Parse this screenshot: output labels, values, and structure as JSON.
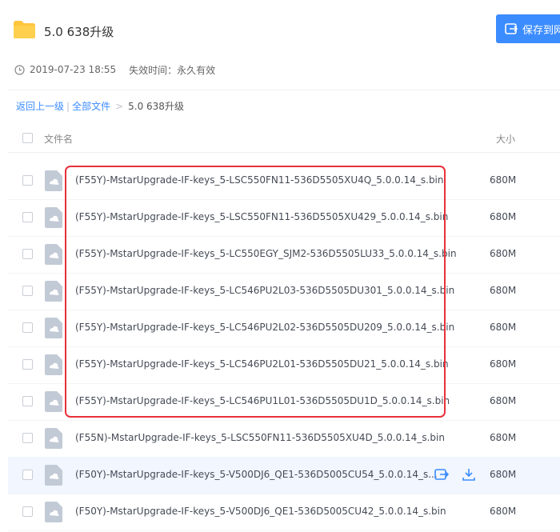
{
  "header": {
    "folder_name": "5.0 638升级",
    "save_button_label": "保存到网盘"
  },
  "meta": {
    "date": "2019-07-23 18:55",
    "expire_label": "失效时间：",
    "expire_value": "永久有效"
  },
  "breadcrumb": {
    "back": "返回上一级",
    "separator": "|",
    "all_files": "全部文件",
    "chevron": ">",
    "current": "5.0 638升级"
  },
  "list": {
    "header_name": "文件名",
    "header_size": "大小",
    "rows": [
      {
        "name": "(F55Y)-MstarUpgrade-IF-keys_5-LSC550FN11-536D5505XU4Q_5.0.0.14_s.bin",
        "size": "680M"
      },
      {
        "name": "(F55Y)-MstarUpgrade-IF-keys_5-LSC550FN11-536D5505XU429_5.0.0.14_s.bin",
        "size": "680M"
      },
      {
        "name": "(F55Y)-MstarUpgrade-IF-keys_5-LC550EGY_SJM2-536D5505LU33_5.0.0.14_s.bin",
        "size": "680M"
      },
      {
        "name": "(F55Y)-MstarUpgrade-IF-keys_5-LC546PU2L03-536D5505DU301_5.0.0.14_s.bin",
        "size": "680M"
      },
      {
        "name": "(F55Y)-MstarUpgrade-IF-keys_5-LC546PU2L02-536D5505DU209_5.0.0.14_s.bin",
        "size": "680M"
      },
      {
        "name": "(F55Y)-MstarUpgrade-IF-keys_5-LC546PU2L01-536D5505DU21_5.0.0.14_s.bin",
        "size": "680M"
      },
      {
        "name": "(F55Y)-MstarUpgrade-IF-keys_5-LC546PU1L01-536D5505DU1D_5.0.0.14_s.bin",
        "size": "680M"
      },
      {
        "name": "(F55N)-MstarUpgrade-IF-keys_5-LSC550FN11-536D5505XU4D_5.0.0.14_s.bin",
        "size": "680M"
      },
      {
        "name": "(F50Y)-MstarUpgrade-IF-keys_5-V500DJ6_QE1-536D5005CU54_5.0.0.14_s...",
        "size": "680M"
      },
      {
        "name": "(F50Y)-MstarUpgrade-IF-keys_5-V500DJ6_QE1-536D5005CU42_5.0.0.14_s.bin",
        "size": "680M"
      }
    ]
  },
  "colors": {
    "accent": "#3b8cff",
    "highlight_box": "#e8303a",
    "folder": "#ffc53d",
    "file_icon": "#c2cad6"
  }
}
